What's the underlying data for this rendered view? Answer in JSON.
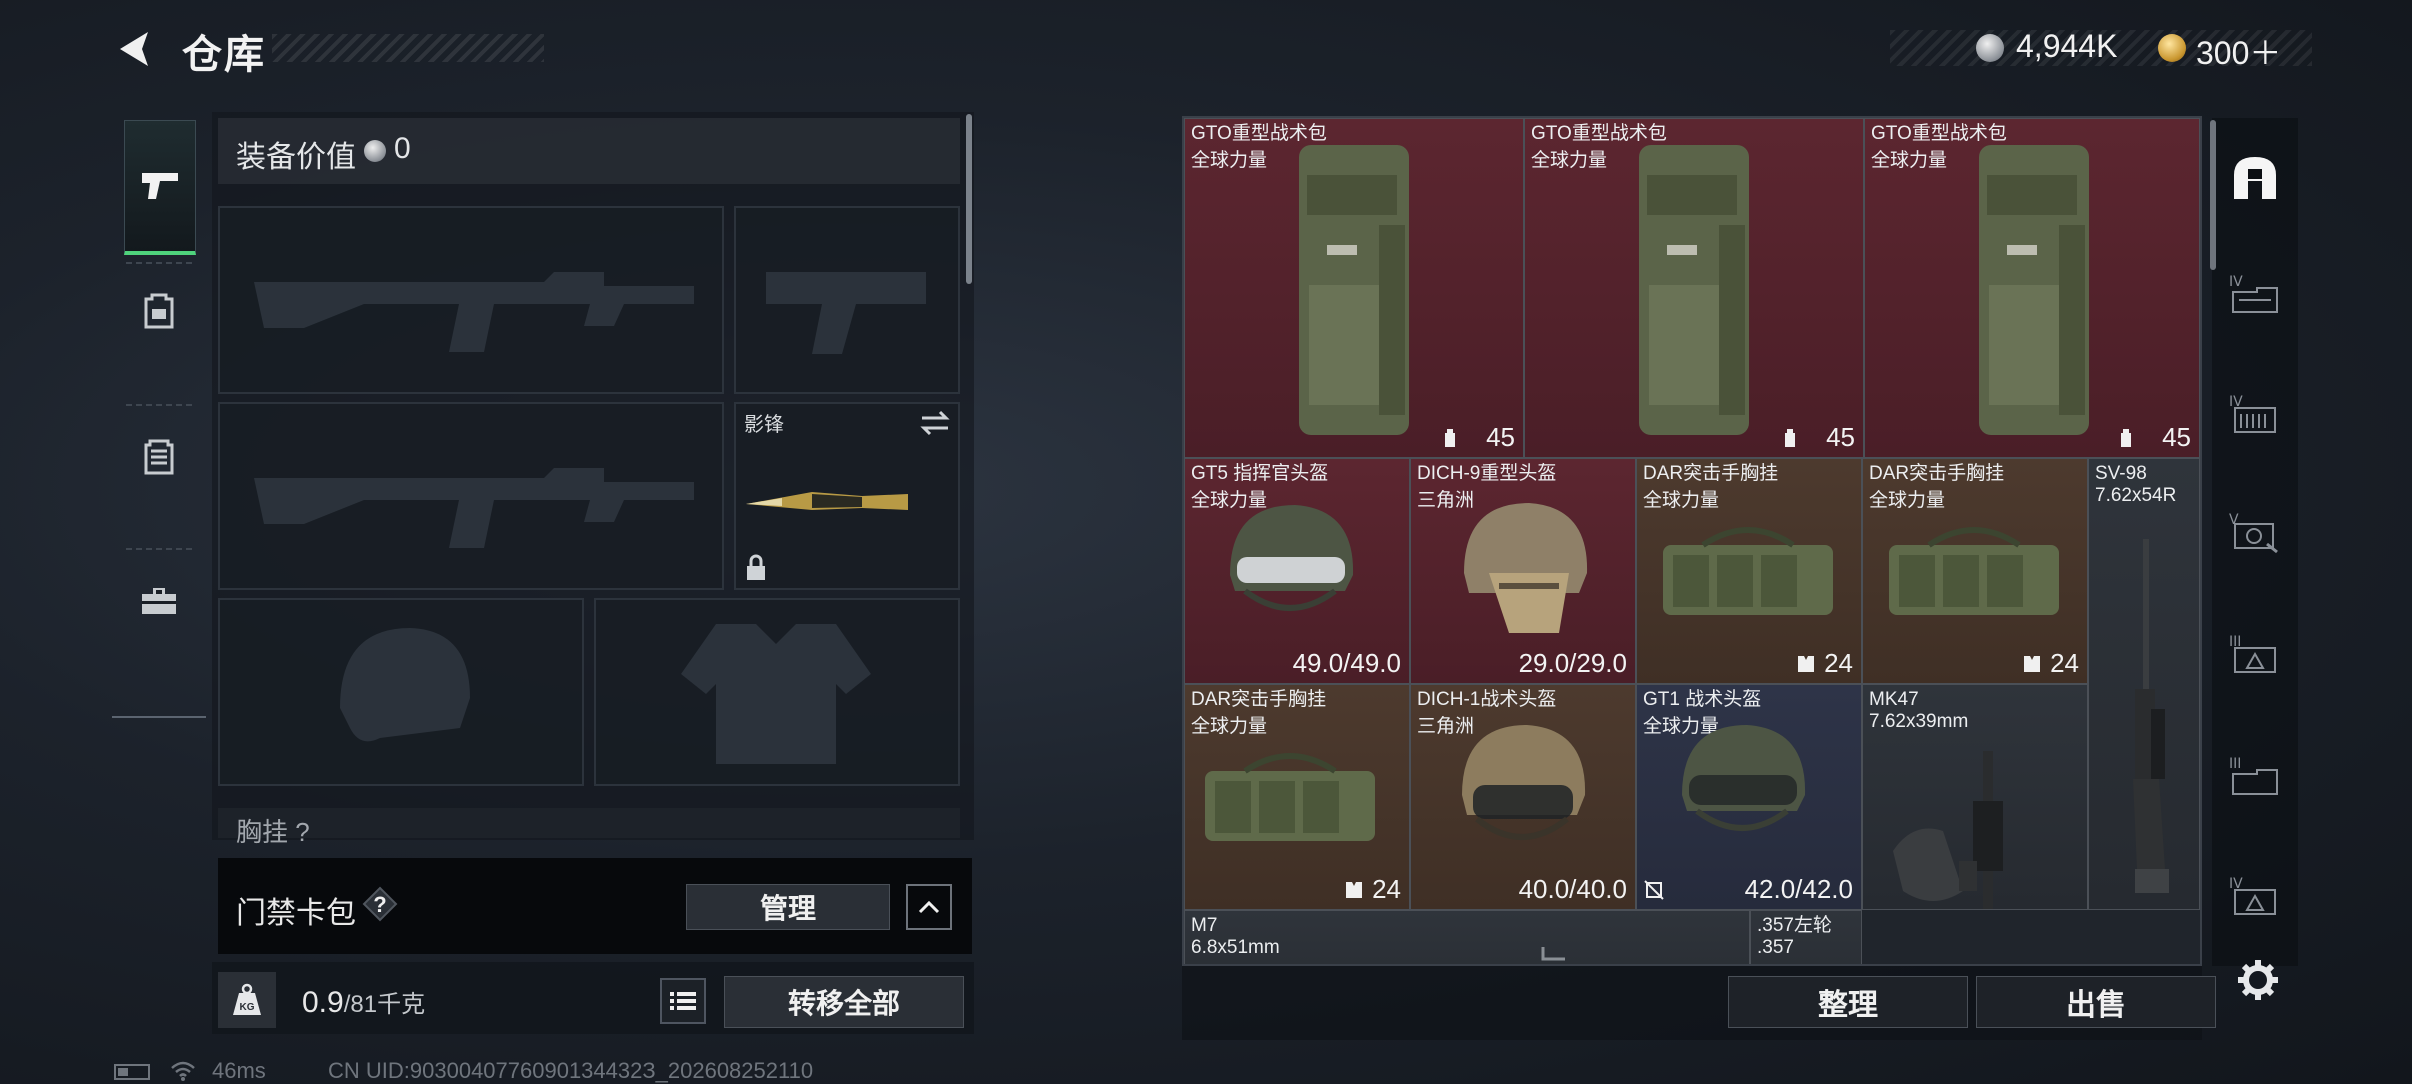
{
  "header": {
    "title": "仓库",
    "currency1": "4,944K",
    "currency2": "300＋"
  },
  "equipment": {
    "value_label": "装备价值",
    "value": "0",
    "melee_label": "影锋",
    "chest_label": "胸挂 ?"
  },
  "access_card": {
    "label": "门禁卡包",
    "help": "?",
    "manage": "管理"
  },
  "weight": {
    "current": "0.9",
    "max": "/81",
    "unit": "千克",
    "transfer_all": "转移全部"
  },
  "status": {
    "latency": "46ms",
    "uid": "CN UID:9030040776090134432З_202608252110"
  },
  "warehouse": {
    "items": [
      {
        "name": "GTO重型战术包",
        "origin": "全球力量",
        "value": "45",
        "kind": "backpack"
      },
      {
        "name": "GTO重型战术包",
        "origin": "全球力量",
        "value": "45",
        "kind": "backpack"
      },
      {
        "name": "GTO重型战术包",
        "origin": "全球力量",
        "value": "45",
        "kind": "backpack"
      },
      {
        "name": "GT5 指挥官头盔",
        "origin": "全球力量",
        "value": "49.0/49.0",
        "kind": "helmet"
      },
      {
        "name": "DICH-9重型头盔",
        "origin": "三角洲",
        "value": "29.0/29.0",
        "kind": "helmet"
      },
      {
        "name": "DAR突击手胸挂",
        "origin": "全球力量",
        "value": "24",
        "kind": "rig"
      },
      {
        "name": "DAR突击手胸挂",
        "origin": "全球力量",
        "value": "24",
        "kind": "rig"
      },
      {
        "name": "SV-98",
        "origin": "7.62x54R",
        "value": "",
        "kind": "rifle"
      },
      {
        "name": "DAR突击手胸挂",
        "origin": "全球力量",
        "value": "24",
        "kind": "rig"
      },
      {
        "name": "DICH-1战术头盔",
        "origin": "三角洲",
        "value": "40.0/40.0",
        "kind": "helmet"
      },
      {
        "name": "GT1 战术头盔",
        "origin": "全球力量",
        "value": "42.0/42.0",
        "kind": "helmet"
      },
      {
        "name": "MK47",
        "origin": "7.62x39mm",
        "value": "",
        "kind": "rifle"
      },
      {
        "name": "M7",
        "origin": "6.8x51mm",
        "value": "",
        "kind": "rifle"
      },
      {
        "name": ".357左轮",
        "origin": ".357",
        "value": "",
        "kind": "pistol"
      }
    ],
    "organize": "整理",
    "sell": "出售"
  },
  "icons": {
    "back": "back-arrow-icon",
    "left_nav": [
      "pistol-icon",
      "backpack-icon",
      "armor-vest-icon",
      "toolbox-icon"
    ],
    "right_nav": [
      "storage-home-icon",
      "tier-iv-icon",
      "tier-iv-icon",
      "tier-v-icon",
      "tier-iii-icon",
      "tier-iii-icon",
      "tier-iv-icon"
    ],
    "settings": "gear-icon"
  },
  "colors": {
    "accent_green": "#4fd37c",
    "rarity_red": "#5c2630",
    "rarity_brown": "#4d3a2e",
    "rarity_blue": "#2e3448"
  }
}
